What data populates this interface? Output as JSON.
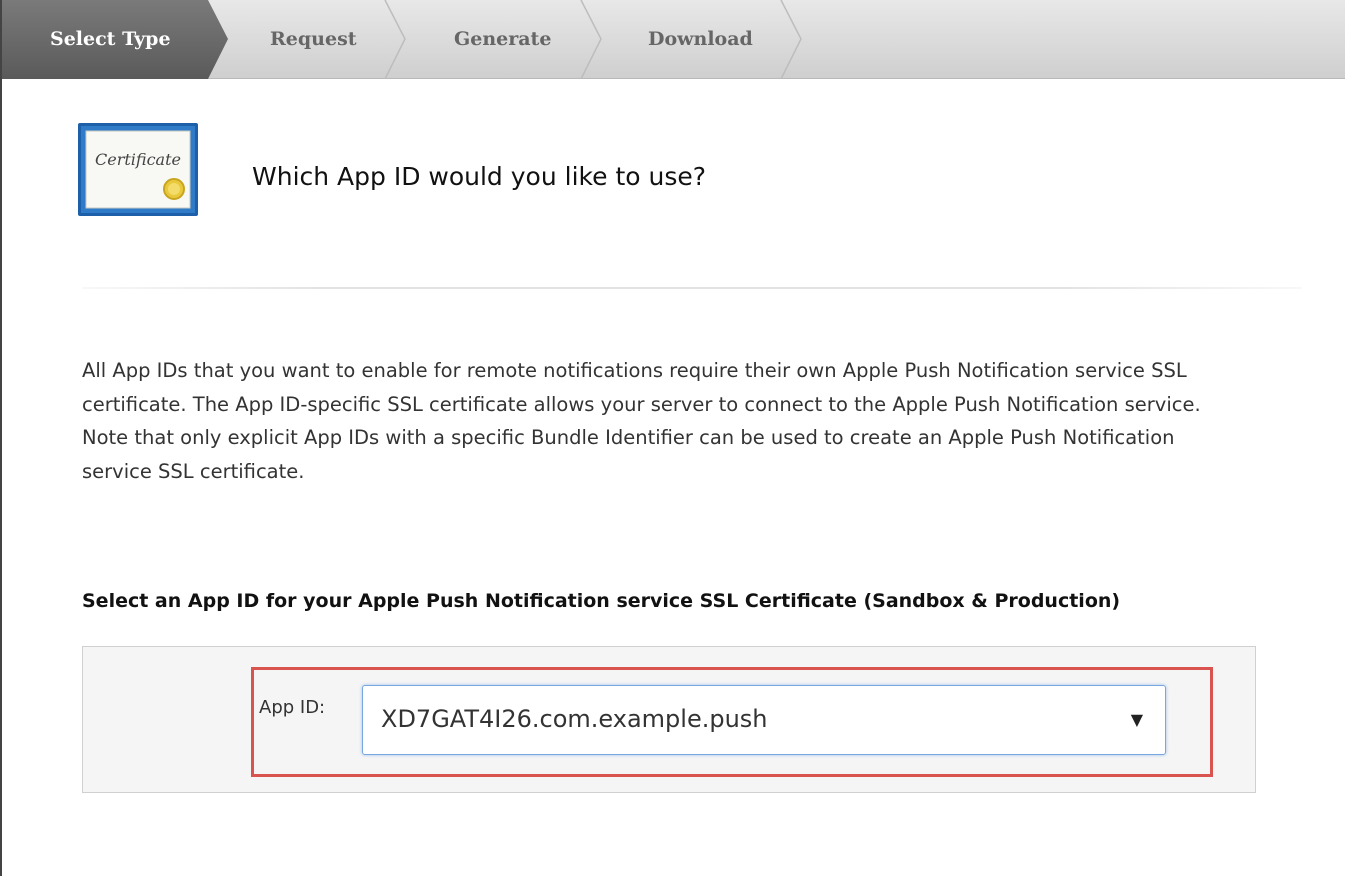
{
  "steps": [
    {
      "label": "Select Type",
      "active": true
    },
    {
      "label": "Request",
      "active": false
    },
    {
      "label": "Generate",
      "active": false
    },
    {
      "label": "Download",
      "active": false
    }
  ],
  "certificate_icon": {
    "icon": "certificate-icon",
    "text": "Certificate"
  },
  "heading": "Which App ID would you like to use?",
  "description": "All App IDs that you want to enable for remote notifications require their own Apple Push Notification service SSL certificate. The App ID-specific SSL certificate allows your server to connect to the Apple Push Notification service. Note that only explicit App IDs with a specific Bundle Identifier can be used to create an Apple Push Notification service SSL certificate.",
  "select_heading": "Select an App ID for your Apple Push Notification service SSL Certificate (Sandbox & Production)",
  "app_id_field": {
    "label": "App ID:",
    "selected_value": "XD7GAT4I26.com.example.push"
  },
  "colors": {
    "active_step": "#666666",
    "highlight_border": "#d9534f",
    "select_border": "#79a7df"
  }
}
